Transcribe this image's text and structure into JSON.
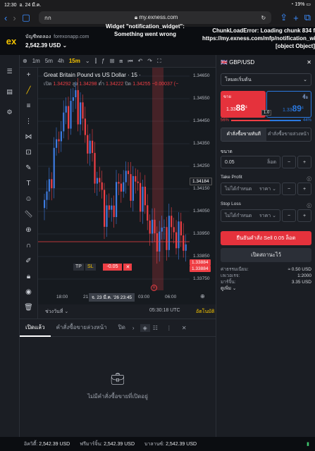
{
  "status": {
    "time": "12:30",
    "date": "อ. 24 มี.ค.",
    "battery": "19%"
  },
  "safari": {
    "tab_label": "กก",
    "url": "my.exness.com"
  },
  "header": {
    "account_label": "บัญชีทดลอง",
    "site": "forexonapp.com",
    "balance": "2,542.39 USD",
    "error_notification": "Widget \"notification_widget\": Something went wrong",
    "error_chunk": "ChunkLoadError: Loading chunk 834 f https://my.exness.com/mfp/notification_widget [object Object]"
  },
  "toolbar": {
    "timeframes": [
      "1m",
      "5m",
      "4h",
      "15m"
    ],
    "active": "15m"
  },
  "chart": {
    "title": "Great Britain Pound vs US Dollar · 15 ·",
    "ohlc": {
      "open_label": "เปิด",
      "open": "1.34292",
      "high_label": "สูง",
      "high": "1.34298",
      "low_label": "ต่ำ",
      "low": "1.34222",
      "close_label": "ปิด",
      "close": "1.34255",
      "change": "−0.00037 (−"
    },
    "y_ticks": [
      "1.34650",
      "1.34550",
      "1.34450",
      "1.34350",
      "1.34250",
      "1.34150",
      "1.34050",
      "1.33950",
      "1.33850",
      "1.33750"
    ],
    "x_ticks": [
      "18:00",
      "21",
      "03:00",
      "06:00"
    ],
    "crosshair_label": "จ. 23 มี.ค. '26  23:45",
    "price_tag_blue": "1.34184",
    "price_tag_red1": "1.33884",
    "price_tag_red2": "1.33884",
    "position_tp": "TP",
    "position_sl": "SL",
    "position_pl": "-0.05",
    "range_label": "ช่วงวันที่",
    "clock": "05:30:18 UTC",
    "auto_label": "อัตโนมัติ"
  },
  "chart_data": {
    "type": "candlestick",
    "title": "Great Britain Pound vs US Dollar · 15 ·",
    "ylim": [
      1.337,
      1.347
    ],
    "x": [
      "18:00",
      "21:00",
      "00:00",
      "03:00",
      "06:00"
    ],
    "close_approx": [
      1.3405,
      1.3445,
      1.346,
      1.343,
      1.34,
      1.342,
      1.3415,
      1.339,
      1.3395,
      1.3388
    ]
  },
  "panel": {
    "symbol": "GBP/USD",
    "mode": "โหมดเริ่มต้น",
    "sell_label": "ขาย",
    "sell_price_main": "1.33",
    "sell_price_big": "88",
    "sell_price_sup": "4",
    "buy_label": "ซื้อ",
    "buy_price_main": "1.33",
    "buy_price_big": "89",
    "buy_price_sup": "4",
    "spread": "1.0",
    "sentiment_sell": "56%",
    "sentiment_buy": "44%",
    "sentiment_sell_frac": 0.56,
    "order_tab_market": "คำสั่งซื้อขายทันที",
    "order_tab_pending": "คำสั่งซื้อขายล่วงหน้า",
    "volume_label": "ขนาด",
    "volume_value": "0.05",
    "volume_unit": "ล็อต",
    "tp_label": "Take Profit",
    "tp_placeholder": "ไม่ได้กำหนด",
    "tp_unit": "ราคา",
    "sl_label": "Stop Loss",
    "sl_placeholder": "ไม่ได้กำหนด",
    "sl_unit": "ราคา",
    "confirm_button": "ยืนยันคำสั่ง Sell 0.05 ล็อต",
    "cancel_button": "เปิดสถานะไว้",
    "fees_label": "ค่าธรรมเนียม:",
    "fees_value": "≈ 0.50 USD",
    "leverage_label": "เลเวอเรจ:",
    "leverage_value": "1:2000",
    "margin_label": "มาร์จิ้น:",
    "margin_value": "3.35 USD",
    "more_label": "ดูเพิ่ม"
  },
  "bottom": {
    "tab_open": "เปิดแล้ว",
    "tab_pending": "คำสั่งซื้อขายล่วงหน้า",
    "tab_closed": "ปิด",
    "empty_message": "ไม่มีคำสั่งซื้อขายที่เปิดอยู่"
  },
  "footer": {
    "equity_label": "อิควิตี้:",
    "equity": "2,542.39 USD",
    "free_margin_label": "ฟรีมาร์จิ้น:",
    "free_margin": "2,542.39 USD",
    "balance_label": "บาลานซ์:",
    "balance": "2,542.39 USD"
  },
  "colors": {
    "accent": "#f6c500",
    "sell": "#e5323c",
    "buy": "#2b79e0",
    "bear": "#ef3f45",
    "bull": "#3d7be0"
  }
}
